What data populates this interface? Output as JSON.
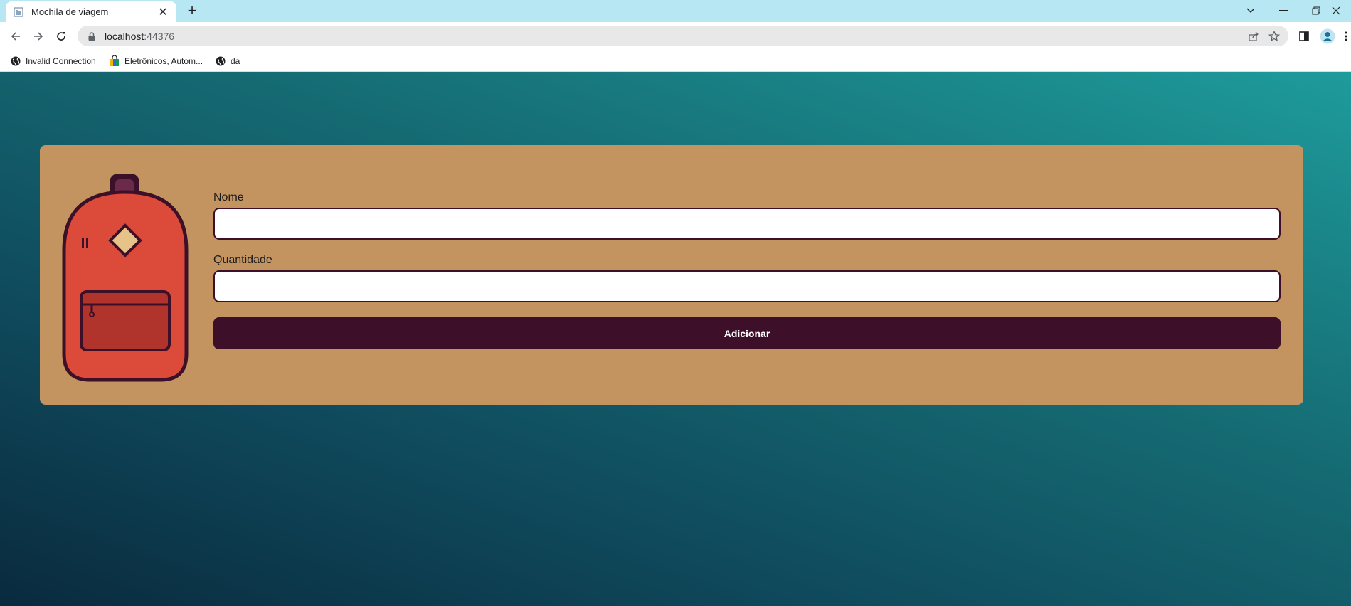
{
  "browser": {
    "tab": {
      "title": "Mochila de viagem",
      "close": "✕"
    },
    "new_tab": "+",
    "window_controls": {
      "dropdown": "⌄",
      "minimize": "—",
      "restore": "❐",
      "close": "✕"
    },
    "address": {
      "host": "localhost",
      "port": ":44376"
    },
    "bookmarks": [
      {
        "label": "Invalid Connection",
        "icon": "globe-icon"
      },
      {
        "label": "Eletrônicos, Autom...",
        "icon": "shopping-bag-icon"
      },
      {
        "label": "da",
        "icon": "globe-icon"
      }
    ]
  },
  "form": {
    "name_label": "Nome",
    "name_value": "",
    "quantity_label": "Quantidade",
    "quantity_value": "",
    "submit_label": "Adicionar"
  },
  "colors": {
    "card": "#c39460",
    "button": "#3d0f29",
    "backpack_body": "#dc4a3a",
    "backpack_outline": "#3d1029",
    "backpack_pocket": "#b0342b",
    "backpack_patch": "#e8c389"
  }
}
